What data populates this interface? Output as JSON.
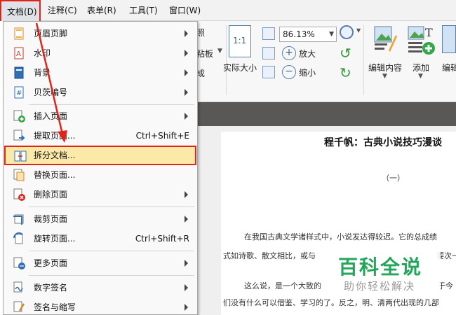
{
  "menubar": {
    "document": "文档(D)",
    "annotate": "注释(C)",
    "form": "表单(R)",
    "tools": "工具(T)",
    "window": "窗口(W)"
  },
  "ribbon": {
    "frag_photo": "照",
    "frag_clipboard": "粘板",
    "frag_cheng": "成",
    "actual_size": "实际大小",
    "zoom_value": "86.13%",
    "zoom_in": "放大",
    "zoom_out": "缩小",
    "edit_content": "编辑内容",
    "add": "添加",
    "edit_frag": "编辑",
    "actual_size_glyph": "1:1"
  },
  "document_menu": {
    "items": [
      {
        "label": "页眉页脚",
        "shortcut": "",
        "submenu": true
      },
      {
        "label": "水印",
        "shortcut": "",
        "submenu": true
      },
      {
        "label": "背景",
        "shortcut": "",
        "submenu": true
      },
      {
        "label": "贝茨编号",
        "shortcut": "",
        "submenu": true
      },
      {
        "label": "插入页面",
        "shortcut": "",
        "submenu": true
      },
      {
        "label": "提取页面...",
        "shortcut": "Ctrl+Shift+E",
        "submenu": false
      },
      {
        "label": "拆分文档...",
        "shortcut": "",
        "submenu": false
      },
      {
        "label": "替换页面...",
        "shortcut": "",
        "submenu": false
      },
      {
        "label": "删除页面",
        "shortcut": "",
        "submenu": true
      },
      {
        "label": "裁剪页面",
        "shortcut": "",
        "submenu": true
      },
      {
        "label": "旋转页面...",
        "shortcut": "Ctrl+Shift+R",
        "submenu": false
      },
      {
        "label": "更多页面",
        "shortcut": "",
        "submenu": true
      },
      {
        "label": "数字签名",
        "shortcut": "",
        "submenu": true
      },
      {
        "label": "签名与缩写",
        "shortcut": "",
        "submenu": true
      }
    ]
  },
  "document_page": {
    "title": "程千帆：古典小说技巧漫谈",
    "section": "（一）",
    "lines": [
      "在我国古典文学诸样式中，小说发达得较迟。它的总成绩",
      "式如诗歌、散文相比，或与",
      "要次一",
      "这么说，是一个大致的",
      "于今",
      "们没有什么可以借鉴、学习的了。反之，明、清两代出现的几部"
    ]
  },
  "watermark": {
    "main": "百科全说",
    "sub": "助你轻松解决"
  },
  "colors": {
    "highlight_border": "#e2231a",
    "highlight_fill": "#fbe9a8",
    "watermark_green": "#22a65a"
  }
}
